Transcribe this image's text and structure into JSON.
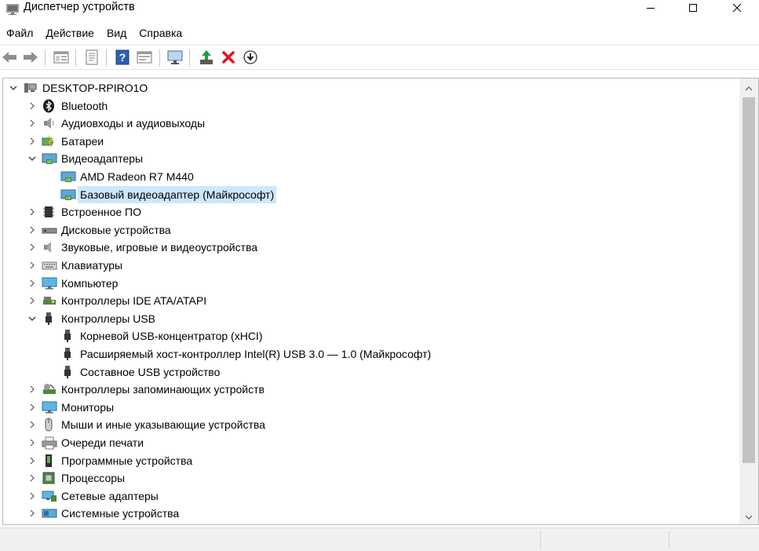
{
  "window": {
    "title": "Диспетчер устройств"
  },
  "menu": [
    "Файл",
    "Действие",
    "Вид",
    "Справка"
  ],
  "toolbar": {
    "buttons": [
      "back-icon",
      "forward-icon",
      "properties-window-icon",
      "document-icon",
      "help-icon",
      "view-icon",
      "monitor-scan-icon",
      "update-driver-icon",
      "uninstall-icon",
      "download-icon"
    ]
  },
  "tree": {
    "root": "DESKTOP-RPIRO1O",
    "items": [
      {
        "label": "Bluetooth",
        "expanded": false,
        "icon": "bluetooth-icon"
      },
      {
        "label": "Аудиовходы и аудиовыходы",
        "expanded": false,
        "icon": "speaker-icon"
      },
      {
        "label": "Батареи",
        "expanded": false,
        "icon": "battery-icon"
      },
      {
        "label": "Видеоадаптеры",
        "expanded": true,
        "icon": "display-adapter-icon",
        "children": [
          "AMD Radeon R7 M440",
          "Базовый видеоадаптер (Майкрософт)"
        ]
      },
      {
        "label": "Встроенное ПО",
        "expanded": false,
        "icon": "firmware-icon"
      },
      {
        "label": "Дисковые устройства",
        "expanded": false,
        "icon": "disk-icon"
      },
      {
        "label": "Звуковые, игровые и видеоустройства",
        "expanded": false,
        "icon": "sound-icon"
      },
      {
        "label": "Клавиатуры",
        "expanded": false,
        "icon": "keyboard-icon"
      },
      {
        "label": "Компьютер",
        "expanded": false,
        "icon": "computer-icon"
      },
      {
        "label": "Контроллеры IDE ATA/ATAPI",
        "expanded": false,
        "icon": "ide-controller-icon"
      },
      {
        "label": "Контроллеры USB",
        "expanded": true,
        "icon": "usb-icon",
        "children": [
          "Корневой USB-концентратор (xHCI)",
          "Расширяемый хост-контроллер Intel(R) USB 3.0 — 1.0 (Майкрософт)",
          "Составное USB устройство"
        ]
      },
      {
        "label": "Контроллеры запоминающих устройств",
        "expanded": false,
        "icon": "storage-controller-icon"
      },
      {
        "label": "Мониторы",
        "expanded": false,
        "icon": "monitor-icon"
      },
      {
        "label": "Мыши и иные указывающие устройства",
        "expanded": false,
        "icon": "mouse-icon"
      },
      {
        "label": "Очереди печати",
        "expanded": false,
        "icon": "printer-icon"
      },
      {
        "label": "Программные устройства",
        "expanded": false,
        "icon": "software-device-icon"
      },
      {
        "label": "Процессоры",
        "expanded": false,
        "icon": "cpu-icon"
      },
      {
        "label": "Сетевые адаптеры",
        "expanded": false,
        "icon": "network-adapter-icon"
      },
      {
        "label": "Системные устройства",
        "expanded": false,
        "icon": "system-device-icon"
      }
    ],
    "selected": "Базовый видеоадаптер (Майкрософт)"
  },
  "colors": {
    "selection": "#cce8ff",
    "uninstall_red": "#e81123",
    "update_green": "#1e9e3c"
  }
}
